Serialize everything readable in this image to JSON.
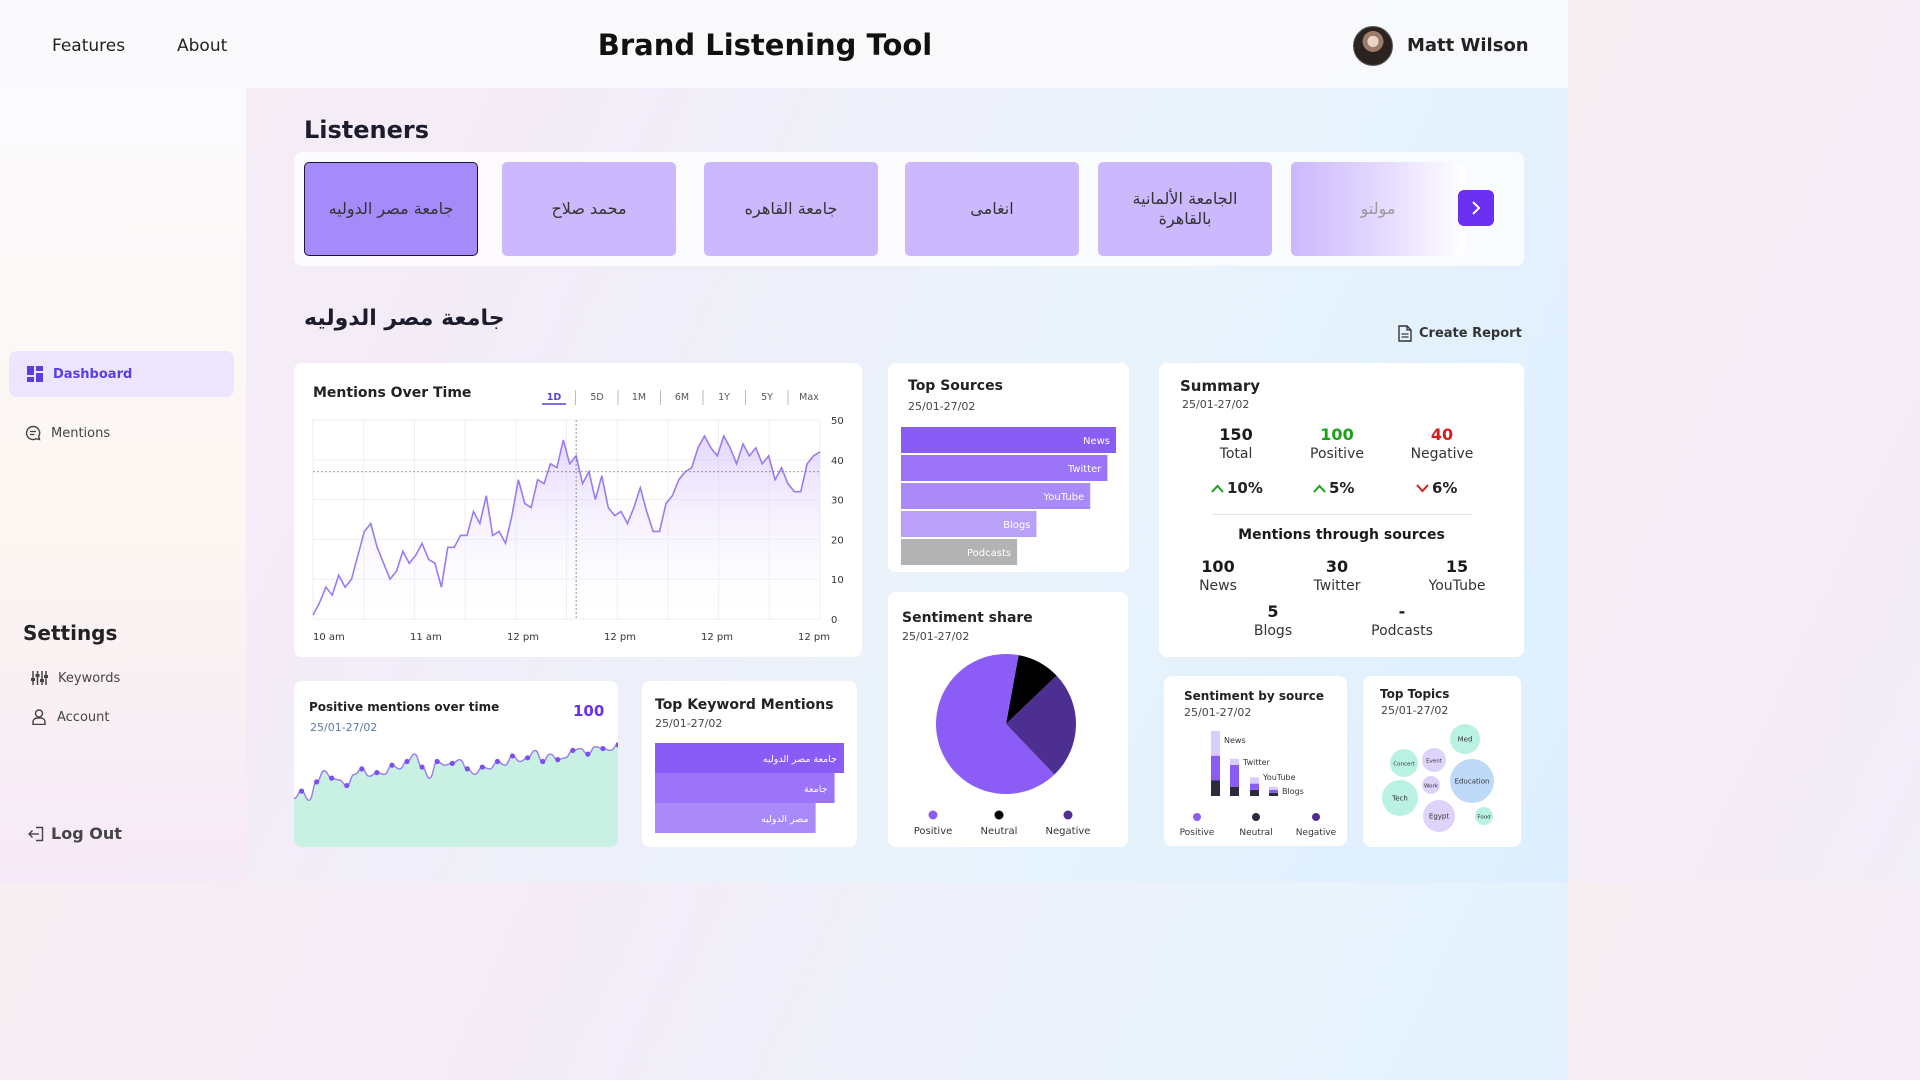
{
  "header": {
    "nav": [
      "Features",
      "About"
    ],
    "title": "Brand Listening Tool",
    "user_name": "Matt Wilson"
  },
  "sidebar": {
    "items": [
      {
        "label": "Dashboard",
        "icon": "dashboard-icon",
        "active": true
      },
      {
        "label": "Mentions",
        "icon": "chat-icon",
        "active": false
      }
    ],
    "settings_title": "Settings",
    "settings_items": [
      {
        "label": "Keywords",
        "icon": "sliders-icon"
      },
      {
        "label": "Account",
        "icon": "user-icon"
      }
    ],
    "logout_label": "Log Out"
  },
  "listeners": {
    "title": "Listeners",
    "items": [
      "جامعة مصر الدوليه",
      "محمد صلاح",
      "جامعة القاهره",
      "انغامى",
      "الجامعة الألمانية بالقاهرة",
      "مولتو"
    ],
    "selected": "جامعة مصر الدوليه"
  },
  "create_report_label": "Create Report",
  "colors": {
    "accent": "#6a2ff0",
    "positive": "#1aa11a",
    "negative": "#d81b1b",
    "light_purple": "#cbb8fd",
    "mint": "#c8f1e4"
  },
  "mentions_over_time": {
    "title": "Mentions Over Time",
    "ranges": [
      "1D",
      "5D",
      "1M",
      "6M",
      "1Y",
      "5Y",
      "Max"
    ],
    "selected_range": "1D",
    "chart_data": {
      "type": "area",
      "x_tick_labels": [
        "10 am",
        "11 am",
        "12 pm",
        "12 pm",
        "12 pm",
        "12 pm"
      ],
      "y_ticks": [
        0,
        10,
        20,
        30,
        40,
        50
      ],
      "ylim": [
        0,
        50
      ],
      "reference_line": 37,
      "values": [
        1,
        4,
        8,
        6,
        11,
        8,
        10,
        16,
        22,
        24,
        18,
        14,
        10,
        12,
        17,
        14,
        16,
        19,
        15,
        14,
        8,
        18,
        18,
        21,
        21,
        27,
        24,
        31,
        21,
        22,
        19,
        26,
        35,
        29,
        28,
        35,
        34,
        39,
        38,
        45,
        39,
        41,
        34,
        37,
        30,
        36,
        28,
        26,
        27,
        24,
        28,
        33,
        27,
        22,
        22,
        29,
        31,
        35,
        37,
        38,
        43,
        46,
        43,
        41,
        46,
        43,
        39,
        44,
        41,
        43,
        39,
        41,
        35,
        38,
        34,
        32,
        32,
        39,
        41,
        42
      ]
    }
  },
  "top_sources": {
    "title": "Top Sources",
    "date": "25/01-27/02",
    "chart_data": {
      "type": "bar",
      "categories": [
        "News",
        "Twitter",
        "YouTube",
        "Blogs",
        "Podcasts"
      ],
      "values": [
        100,
        96,
        88,
        63,
        54
      ]
    }
  },
  "summary": {
    "title": "Summary",
    "date": "25/01-27/02",
    "stats": [
      {
        "value": "150",
        "label": "Total"
      },
      {
        "value": "100",
        "label": "Positive"
      },
      {
        "value": "40",
        "label": "Negative"
      }
    ],
    "changes": [
      {
        "value": "10%",
        "direction": "up"
      },
      {
        "value": "5%",
        "direction": "up"
      },
      {
        "value": "6%",
        "direction": "down"
      }
    ],
    "sources_title": "Mentions through sources",
    "sources": [
      {
        "value": "100",
        "label": "News"
      },
      {
        "value": "30",
        "label": "Twitter"
      },
      {
        "value": "15",
        "label": "YouTube"
      },
      {
        "value": "5",
        "label": "Blogs"
      },
      {
        "value": "-",
        "label": "Podcasts"
      }
    ]
  },
  "positive_mentions": {
    "title": "Positive mentions over time",
    "date": "25/01-27/02",
    "count": "100",
    "chart_data": {
      "type": "area",
      "values": [
        10,
        14,
        9,
        19,
        25,
        21,
        20,
        17,
        23,
        26,
        22,
        24,
        23,
        28,
        26,
        30,
        34,
        27,
        21,
        30,
        28,
        29,
        31,
        26,
        23,
        27,
        26,
        30,
        28,
        33,
        30,
        32,
        36,
        30,
        34,
        31,
        32,
        36,
        37,
        34,
        38,
        37,
        36,
        39
      ]
    }
  },
  "top_keywords": {
    "title": "Top Keyword Mentions",
    "date": "25/01-27/02",
    "chart_data": {
      "type": "bar",
      "categories": [
        "جامعة مصر الدوليه",
        "جامعة",
        "مصر الدوليه"
      ],
      "values": [
        100,
        95,
        85
      ]
    }
  },
  "sentiment_share": {
    "title": "Sentiment share",
    "date": "25/01-27/02",
    "legend": [
      "Positive",
      "Neutral",
      "Negative"
    ],
    "chart_data": {
      "type": "pie",
      "categories": [
        "Positive",
        "Neutral",
        "Negative"
      ],
      "values": [
        65,
        10,
        25
      ],
      "colors": [
        "#8b5cf6",
        "#000000",
        "#4c2f91"
      ]
    }
  },
  "sentiment_by_source": {
    "title": "Sentiment by source",
    "date": "25/01-27/02",
    "source_labels": [
      "News",
      "Twitter",
      "YouTube",
      "Blogs"
    ],
    "legend": [
      "Positive",
      "Neutral",
      "Negative"
    ],
    "chart_data": {
      "type": "bar",
      "categories": [
        "News",
        "Twitter",
        "YouTube",
        "Blogs"
      ],
      "series": [
        {
          "name": "Positive",
          "values": [
            8,
            7,
            2,
            1
          ]
        },
        {
          "name": "Neutral",
          "values": [
            5,
            3,
            2,
            1
          ]
        },
        {
          "name": "Negative",
          "values": [
            8,
            2,
            2,
            1
          ]
        }
      ]
    }
  },
  "top_topics": {
    "title": "Top Topics",
    "date": "25/01-27/02",
    "topics": [
      "Med",
      "Concert",
      "Event",
      "Education",
      "Work",
      "Tech",
      "Egypt",
      "Food"
    ]
  }
}
